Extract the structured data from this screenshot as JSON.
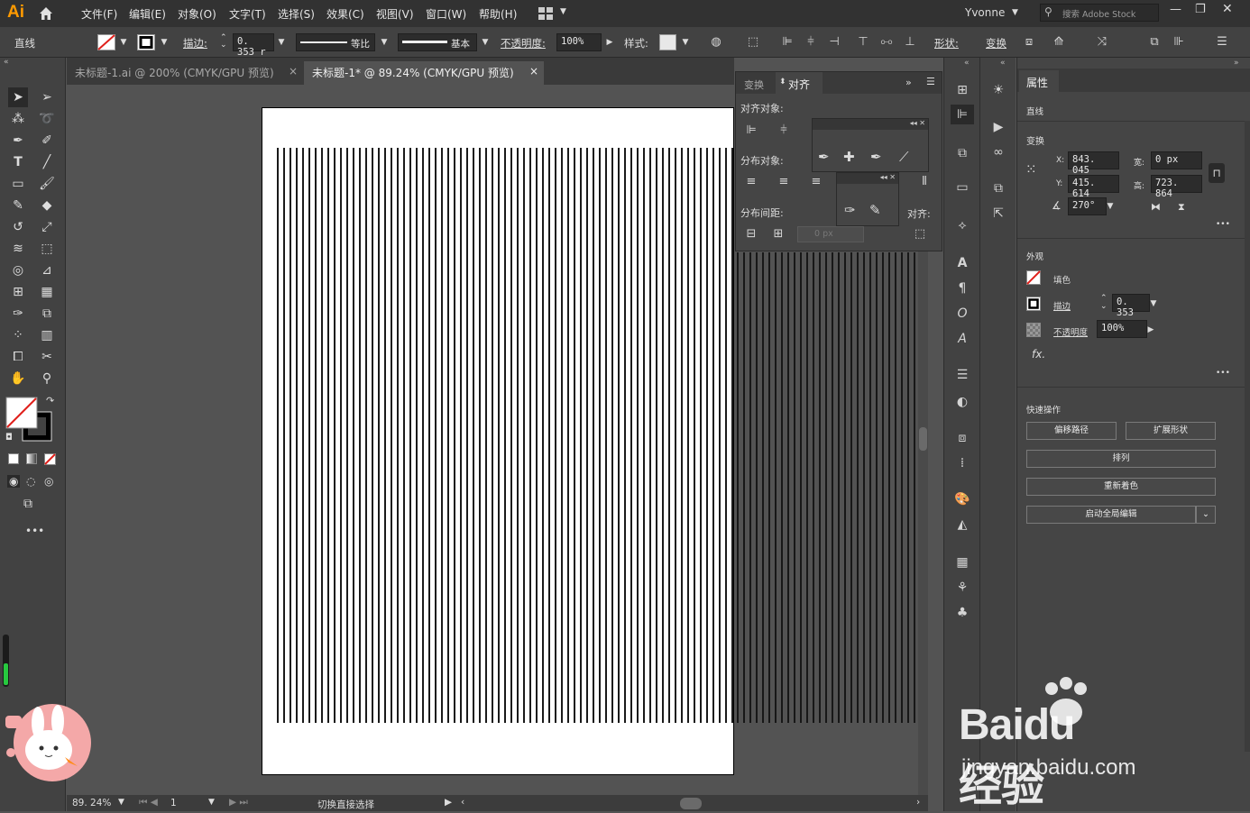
{
  "app": {
    "logo": "Ai",
    "user": "Yvonne",
    "search_placeholder": "搜索 Adobe Stock"
  },
  "menu": [
    "文件(F)",
    "编辑(E)",
    "对象(O)",
    "文字(T)",
    "选择(S)",
    "效果(C)",
    "视图(V)",
    "窗口(W)",
    "帮助(H)"
  ],
  "control_bar": {
    "object_type": "直线",
    "stroke_label": "描边:",
    "stroke_value": "0. 353 r",
    "profile_label": "等比",
    "brush_label": "基本",
    "opacity_label": "不透明度:",
    "opacity_value": "100%",
    "style_label": "样式:",
    "shape_label": "形状:",
    "transform_label": "变换"
  },
  "tabs": [
    {
      "label": "未标题-1.ai @ 200% (CMYK/GPU 预览)",
      "close": "×"
    },
    {
      "label": "未标题-1* @ 89.24% (CMYK/GPU 预览)",
      "close": "×"
    }
  ],
  "align_panel": {
    "tab_transform": "变换",
    "tab_align": "对齐",
    "align_objects": "对齐对象:",
    "distribute_objects": "分布对象:",
    "distribute_spacing": "分布间距:",
    "align_to": "对齐:",
    "spacing_value": "0 px"
  },
  "properties": {
    "tab": "属性",
    "object": "直线",
    "transform_title": "变换",
    "x_label": "X:",
    "x": "843. 045",
    "w_label": "宽:",
    "w": "0 px",
    "y_label": "Y:",
    "y": "415. 614",
    "h_label": "高:",
    "h": "723. 864",
    "angle": "270°",
    "appearance_title": "外观",
    "fill_label": "填色",
    "stroke_label": "描边",
    "stroke_value": "0. 353",
    "opacity_label": "不透明度",
    "opacity_value": "100%",
    "fx": "fx.",
    "quick_title": "快速操作",
    "btn_offset": "偏移路径",
    "btn_expand": "扩展形状",
    "btn_arrange": "排列",
    "btn_recolor": "重新着色",
    "btn_global": "启动全局编辑",
    "more": "•••"
  },
  "status": {
    "zoom": "89. 24%",
    "page": "1",
    "tool": "切换直接选择"
  },
  "artwork": {
    "left_line_count": 73,
    "right_line_count": 30
  },
  "watermark": {
    "brand": "Baidu经验",
    "url": "jingyan.baidu.com"
  },
  "colors": {
    "accent": "#ff9a00",
    "ui_dark": "#323232",
    "panel": "#454545"
  }
}
